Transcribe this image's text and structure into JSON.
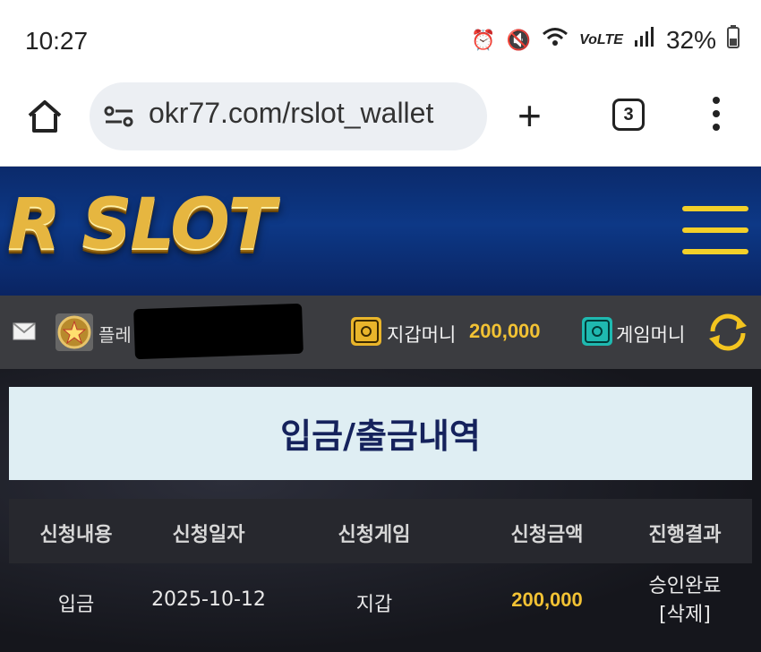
{
  "status_bar": {
    "time": "10:27",
    "network": "VoLTE",
    "battery": "32%"
  },
  "browser": {
    "url": "okr77.com/rslot_wallet",
    "tab_count": "3"
  },
  "site": {
    "logo": "R SLOT",
    "accent_color": "#f2c234",
    "header_color": "#0d3886"
  },
  "info_bar": {
    "user_prefix": "플레",
    "wallet_label": "지갑머니",
    "wallet_value": "200,000",
    "game_label": "게임머니"
  },
  "page": {
    "title": "입금/출금내역"
  },
  "table": {
    "headers": [
      "신청내용",
      "신청일자",
      "신청게임",
      "신청금액",
      "진행결과"
    ],
    "rows": [
      {
        "type": "입금",
        "date": "2025-10-12",
        "game": "지갑",
        "amount": "200,000",
        "result": "승인완료",
        "action": "[삭제]"
      }
    ]
  }
}
